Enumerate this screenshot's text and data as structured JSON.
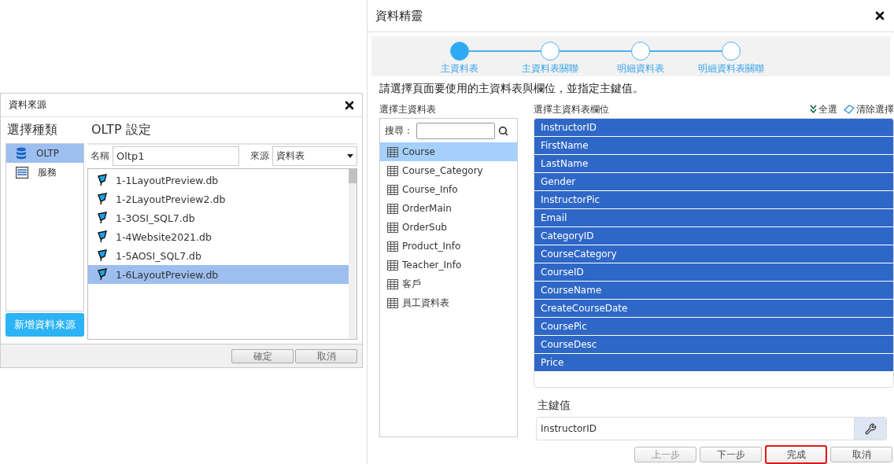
{
  "source_dialog": {
    "title": "資料來源",
    "category_heading": "選擇種類",
    "categories": [
      {
        "label": "OLTP",
        "kind": "database",
        "selected": true
      },
      {
        "label": "服務",
        "kind": "server",
        "selected": false
      }
    ],
    "add_button": "新增資料來源",
    "settings_heading": "OLTP 設定",
    "name_label": "名稱",
    "name_value": "Oltp1",
    "source_label": "來源",
    "source_value": "資料表",
    "files": [
      {
        "label": "1-1LayoutPreview.db",
        "selected": false
      },
      {
        "label": "1-2LayoutPreview2.db",
        "selected": false
      },
      {
        "label": "1-3OSI_SQL7.db",
        "selected": false
      },
      {
        "label": "1-4Website2021.db",
        "selected": false
      },
      {
        "label": "1-5AOSI_SQL7.db",
        "selected": false
      },
      {
        "label": "1-6LayoutPreview.db",
        "selected": true
      }
    ],
    "buttons": [
      "確定",
      "取消"
    ]
  },
  "wizard": {
    "title": "資料精靈",
    "steps": [
      {
        "label": "主資料表",
        "selected": true
      },
      {
        "label": "主資料表關聯",
        "selected": false
      },
      {
        "label": "明細資料表",
        "selected": false
      },
      {
        "label": "明細資料表關聯",
        "selected": false
      }
    ],
    "instruction": "請選擇頁面要使用的主資料表與欄位，並指定主鍵值。",
    "tables_heading": "選擇主資料表",
    "search_label": "搜尋：",
    "tables": [
      {
        "label": "Course",
        "selected": true
      },
      {
        "label": "Course_Category",
        "selected": false
      },
      {
        "label": "Course_Info",
        "selected": false
      },
      {
        "label": "OrderMain",
        "selected": false
      },
      {
        "label": "OrderSub",
        "selected": false
      },
      {
        "label": "Product_Info",
        "selected": false
      },
      {
        "label": "Teacher_Info",
        "selected": false
      },
      {
        "label": "客戶",
        "selected": false
      },
      {
        "label": "員工資料表",
        "selected": false
      }
    ],
    "fields_heading": "選擇主資料表欄位",
    "select_all": "全選",
    "clear_selection": "清除選擇",
    "fields": [
      {
        "label": "InstructorID",
        "selected": true
      },
      {
        "label": "FirstName",
        "selected": true
      },
      {
        "label": "LastName",
        "selected": true
      },
      {
        "label": "Gender",
        "selected": true
      },
      {
        "label": "InstructorPic",
        "selected": true
      },
      {
        "label": "Email",
        "selected": true
      },
      {
        "label": "CategoryID",
        "selected": true
      },
      {
        "label": "CourseCategory",
        "selected": true
      },
      {
        "label": "CourseID",
        "selected": true
      },
      {
        "label": "CourseName",
        "selected": true
      },
      {
        "label": "CreateCourseDate",
        "selected": true
      },
      {
        "label": "CoursePic",
        "selected": true
      },
      {
        "label": "CourseDesc",
        "selected": true
      },
      {
        "label": "Price",
        "selected": true
      }
    ],
    "key_label": "主鍵值",
    "key_value": "InstructorID",
    "buttons": [
      {
        "label": "上一步",
        "disabled": true,
        "highlighted": false
      },
      {
        "label": "下一步",
        "disabled": false,
        "highlighted": false
      },
      {
        "label": "完成",
        "disabled": false,
        "highlighted": true
      },
      {
        "label": "取消",
        "disabled": false,
        "highlighted": false
      }
    ]
  }
}
